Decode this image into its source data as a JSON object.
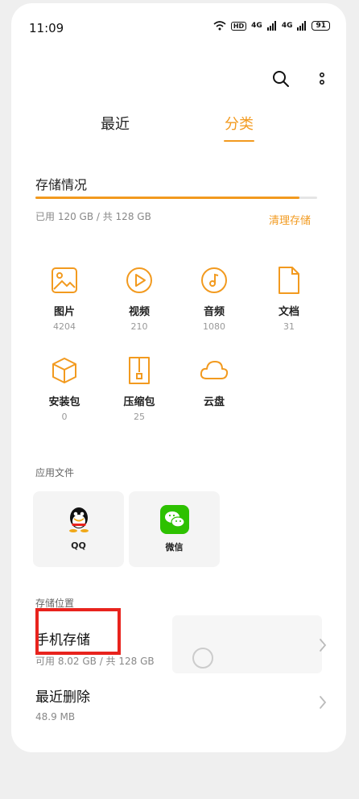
{
  "status_bar": {
    "time": "11:09",
    "hd": "HD",
    "signal1": "4G",
    "signal2": "4G",
    "battery": "91"
  },
  "tabs": {
    "recent": "最近",
    "category": "分类"
  },
  "storage": {
    "title": "存储情况",
    "used_text": "已用 120 GB / 共 128 GB",
    "clean_label": "清理存储",
    "used_fraction": 0.9375
  },
  "categories": [
    {
      "label": "图片",
      "count": "4204",
      "icon": "image-icon"
    },
    {
      "label": "视频",
      "count": "210",
      "icon": "video-icon"
    },
    {
      "label": "音频",
      "count": "1080",
      "icon": "audio-icon"
    },
    {
      "label": "文档",
      "count": "31",
      "icon": "document-icon"
    },
    {
      "label": "安装包",
      "count": "0",
      "icon": "package-icon"
    },
    {
      "label": "压缩包",
      "count": "25",
      "icon": "archive-icon"
    },
    {
      "label": "云盘",
      "count": "",
      "icon": "cloud-icon"
    }
  ],
  "app_files": {
    "section_label": "应用文件",
    "apps": [
      {
        "name": "QQ",
        "icon": "qq-icon"
      },
      {
        "name": "微信",
        "icon": "wechat-icon"
      }
    ]
  },
  "locations": {
    "section_label": "存储位置",
    "phone": {
      "title": "手机存储",
      "sub": "可用 8.02 GB / 共 128 GB"
    },
    "deleted": {
      "title": "最近删除",
      "sub": "48.9 MB"
    }
  },
  "colors": {
    "accent": "#f29a1f",
    "highlight": "#e8231d"
  }
}
